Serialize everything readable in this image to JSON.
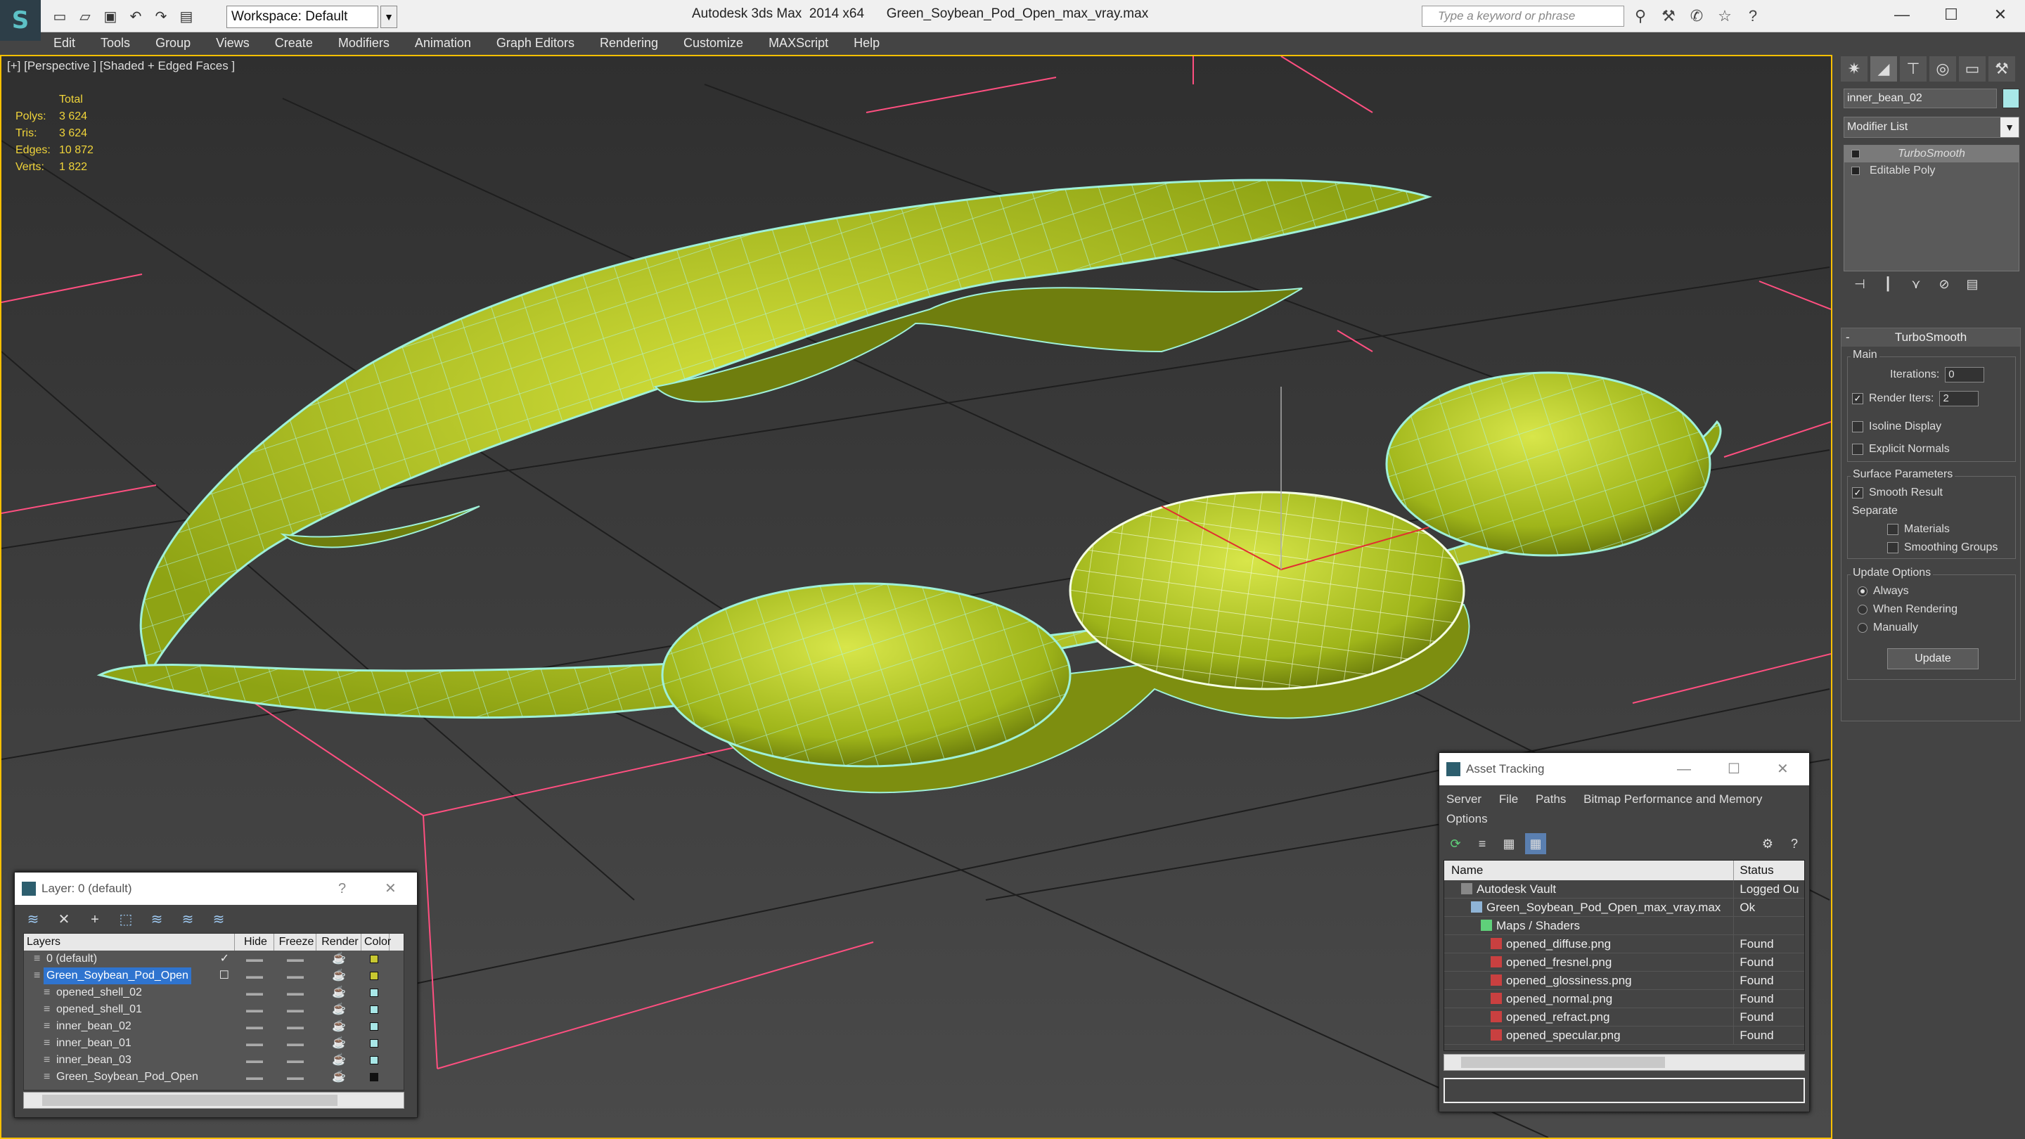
{
  "titlebar": {
    "logo": "S",
    "workspace": "Workspace: Default",
    "app_title": "Autodesk 3ds Max  2014 x64      Green_Soybean_Pod_Open_max_vray.max",
    "search_placeholder": "Type a keyword or phrase"
  },
  "menubar": {
    "items": [
      "Edit",
      "Tools",
      "Group",
      "Views",
      "Create",
      "Modifiers",
      "Animation",
      "Graph Editors",
      "Rendering",
      "Customize",
      "MAXScript",
      "Help"
    ]
  },
  "viewport": {
    "label": "[+] [Perspective ] [Shaded + Edged Faces ]",
    "stats": {
      "header": "Total",
      "rows": [
        [
          "Polys:",
          "3 624"
        ],
        [
          "Tris:",
          "3 624"
        ],
        [
          "Edges:",
          "10 872"
        ],
        [
          "Verts:",
          "1 822"
        ]
      ]
    }
  },
  "command_panel": {
    "object_name": "inner_bean_02",
    "object_color": "#a8e7e7",
    "modifier_list": "Modifier List",
    "stack": [
      "TurboSmooth",
      "Editable Poly"
    ],
    "rollout_title": "TurboSmooth",
    "main_label": "Main",
    "iterations_label": "Iterations:",
    "iterations_value": "0",
    "render_iters_label": "Render Iters:",
    "render_iters_value": "2",
    "isoline_label": "Isoline Display",
    "explicit_normals_label": "Explicit Normals",
    "surface_label": "Surface Parameters",
    "smooth_result_label": "Smooth Result",
    "separate_label": "Separate",
    "materials_label": "Materials",
    "smoothing_groups_label": "Smoothing Groups",
    "update_options_label": "Update Options",
    "always_label": "Always",
    "when_rendering_label": "When Rendering",
    "manually_label": "Manually",
    "update_button": "Update"
  },
  "layer_dialog": {
    "title": "Layer: 0 (default)",
    "help": "?",
    "close": "✕",
    "columns": [
      "Layers",
      "Hide",
      "Freeze",
      "Render",
      "Color"
    ],
    "rows": [
      {
        "name": "0 (default)",
        "color": "#c8c830",
        "indent": 1,
        "check": "✓"
      },
      {
        "name": "Green_Soybean_Pod_Open",
        "color": "#c8c830",
        "indent": 1,
        "check": "☐",
        "selected": true
      },
      {
        "name": "opened_shell_02",
        "color": "#a8e7e7",
        "indent": 2,
        "check": ""
      },
      {
        "name": "opened_shell_01",
        "color": "#a8e7e7",
        "indent": 2,
        "check": ""
      },
      {
        "name": "inner_bean_02",
        "color": "#a8e7e7",
        "indent": 2,
        "check": ""
      },
      {
        "name": "inner_bean_01",
        "color": "#a8e7e7",
        "indent": 2,
        "check": ""
      },
      {
        "name": "inner_bean_03",
        "color": "#a8e7e7",
        "indent": 2,
        "check": ""
      },
      {
        "name": "Green_Soybean_Pod_Open",
        "color": "#111111",
        "indent": 2,
        "check": ""
      }
    ]
  },
  "asset_dialog": {
    "title": "Asset Tracking",
    "menu": [
      "Server",
      "File",
      "Paths",
      "Bitmap Performance and Memory",
      "Options"
    ],
    "columns": [
      "Name",
      "Status"
    ],
    "rows": [
      {
        "name": "Autodesk Vault",
        "status": "Logged Ou",
        "indent": 1,
        "icon": "vault-icon"
      },
      {
        "name": "Green_Soybean_Pod_Open_max_vray.max",
        "status": "Ok",
        "indent": 2,
        "icon": "max-file-icon"
      },
      {
        "name": "Maps / Shaders",
        "status": "",
        "indent": 3,
        "icon": "maps-icon"
      },
      {
        "name": "opened_diffuse.png",
        "status": "Found",
        "indent": 4,
        "icon": "png-icon"
      },
      {
        "name": "opened_fresnel.png",
        "status": "Found",
        "indent": 4,
        "icon": "png-icon"
      },
      {
        "name": "opened_glossiness.png",
        "status": "Found",
        "indent": 4,
        "icon": "png-icon"
      },
      {
        "name": "opened_normal.png",
        "status": "Found",
        "indent": 4,
        "icon": "png-icon"
      },
      {
        "name": "opened_refract.png",
        "status": "Found",
        "indent": 4,
        "icon": "png-icon"
      },
      {
        "name": "opened_specular.png",
        "status": "Found",
        "indent": 4,
        "icon": "png-icon"
      }
    ]
  },
  "colors": {
    "accent": "#ffc000",
    "pod": "#b5cc2a",
    "wire": "#9ff0d8",
    "grid": "#ff4477"
  }
}
